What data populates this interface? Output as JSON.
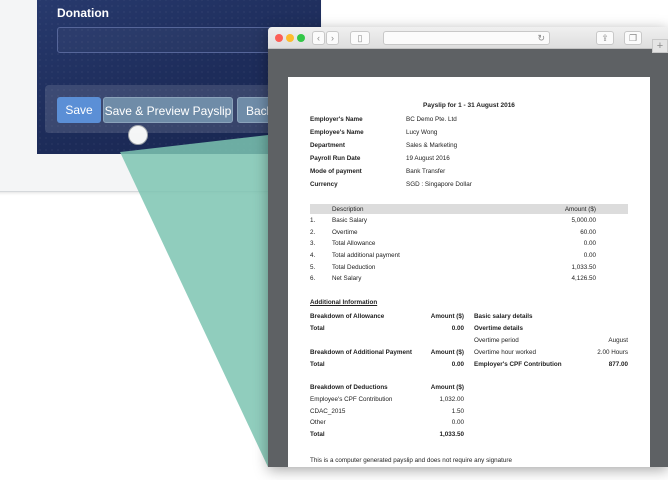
{
  "tablet": {
    "donation_label": "Donation",
    "donation_value": "",
    "buttons": {
      "save": "Save",
      "save_preview": "Save & Preview Payslip",
      "back": "Back"
    }
  },
  "browser": {
    "address": ""
  },
  "payslip": {
    "title": "Payslip for 1 - 31 August 2016",
    "info": [
      {
        "label": "Employer's Name",
        "value": "BC Demo Pte. Ltd"
      },
      {
        "label": "Employee's Name",
        "value": "Lucy Wong"
      },
      {
        "label": "Department",
        "value": "Sales & Marketing"
      },
      {
        "label": "Payroll Run Date",
        "value": "19 August 2016"
      },
      {
        "label": "Mode of payment",
        "value": "Bank Transfer"
      },
      {
        "label": "Currency",
        "value": "SGD : Singapore Dollar"
      }
    ],
    "table": {
      "header_description": "Description",
      "header_amount": "Amount ($)",
      "rows": [
        {
          "no": "1.",
          "description": "Basic Salary",
          "amount": "5,000.00"
        },
        {
          "no": "2.",
          "description": "Overtime",
          "amount": "60.00"
        },
        {
          "no": "3.",
          "description": "Total Allowance",
          "amount": "0.00"
        },
        {
          "no": "4.",
          "description": "Total additional payment",
          "amount": "0.00"
        },
        {
          "no": "5.",
          "description": "Total Deduction",
          "amount": "1,033.50"
        },
        {
          "no": "6.",
          "description": "Net Salary",
          "amount": "4,126.50"
        }
      ]
    },
    "additional_information": "Additional Information",
    "allowance": {
      "header": "Breakdown of Allowance",
      "amount_header": "Amount ($)",
      "total_label": "Total",
      "total": "0.00"
    },
    "additional_payment": {
      "header": "Breakdown of Additional Payment",
      "amount_header": "Amount ($)",
      "total_label": "Total",
      "total": "0.00"
    },
    "deductions": {
      "header": "Breakdown of Deductions",
      "amount_header": "Amount ($)",
      "items": [
        {
          "label": "Employee's CPF Contribution",
          "amount": "1,032.00"
        },
        {
          "label": "CDAC_2015",
          "amount": "1.50"
        },
        {
          "label": "Other",
          "amount": "0.00"
        }
      ],
      "total_label": "Total",
      "total": "1,033.50"
    },
    "basic_salary_details": "Basic salary details",
    "overtime_details": "Overtime details",
    "overtime_period_label": "Overtime period",
    "overtime_period": "August",
    "overtime_hours_label": "Overtime hour worked",
    "overtime_hours": "2.00 Hours",
    "employer_cpf_label": "Employer's CPF Contribution",
    "employer_cpf": "877.00",
    "footer": "This is a computer generated payslip and does not require any signature"
  },
  "colors": {
    "beam": "#7cc4b2",
    "tablet_screen": "#1f2e5e",
    "save_button": "#5b8fd6",
    "table_header": "#dcdcdc"
  }
}
